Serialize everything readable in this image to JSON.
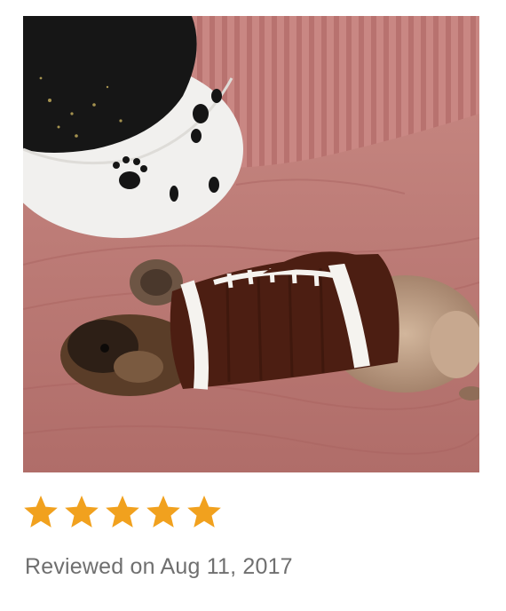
{
  "review": {
    "photo_icon": "review-photo",
    "rating": 5,
    "max_rating": 5,
    "star_color": "#f1a11e",
    "date_text": "Reviewed on Aug 11, 2017"
  }
}
